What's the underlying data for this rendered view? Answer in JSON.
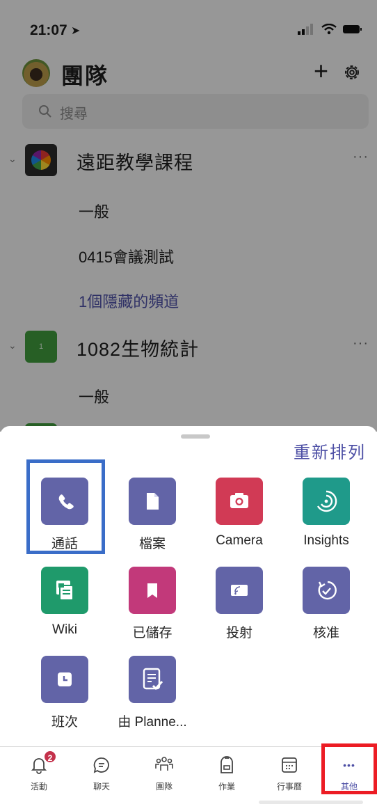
{
  "status": {
    "time": "21:07"
  },
  "header": {
    "title": "團隊",
    "add_label": "+"
  },
  "search": {
    "placeholder": "搜尋"
  },
  "teams": [
    {
      "name": "遠距教學課程",
      "channels": [
        "一般",
        "0415會議測試"
      ],
      "hidden_channels": "1個隱藏的頻道",
      "more": "···"
    },
    {
      "name": "1082生物統計",
      "logo_text": "1",
      "channels": [
        "一般"
      ],
      "more": "···"
    }
  ],
  "sheet": {
    "reorder_label": "重新排列",
    "apps": [
      {
        "label": "通話",
        "icon": "phone-icon",
        "color": "#6264a7"
      },
      {
        "label": "檔案",
        "icon": "file-icon",
        "color": "#6264a7"
      },
      {
        "label": "Camera",
        "icon": "camera-icon",
        "color": "#d13a55"
      },
      {
        "label": "Insights",
        "icon": "insights-icon",
        "color": "#1f9a8a"
      },
      {
        "label": "Wiki",
        "icon": "wiki-icon",
        "color": "#1f9a6b"
      },
      {
        "label": "已儲存",
        "icon": "bookmark-icon",
        "color": "#c2397a"
      },
      {
        "label": "投射",
        "icon": "cast-icon",
        "color": "#6264a7"
      },
      {
        "label": "核准",
        "icon": "approvals-icon",
        "color": "#6264a7"
      },
      {
        "label": "班次",
        "icon": "shifts-clock-icon",
        "color": "#6264a7"
      },
      {
        "label": "由 Planne...",
        "icon": "planner-icon",
        "color": "#6264a7"
      }
    ]
  },
  "tabbar": {
    "tabs": [
      {
        "label": "活動",
        "icon": "bell-icon",
        "badge": "2"
      },
      {
        "label": "聊天",
        "icon": "chat-icon"
      },
      {
        "label": "團隊",
        "icon": "teams-icon"
      },
      {
        "label": "作業",
        "icon": "assignments-icon"
      },
      {
        "label": "行事曆",
        "icon": "calendar-icon"
      },
      {
        "label": "其他",
        "icon": "more-dots-icon",
        "glyph": "•••"
      }
    ]
  },
  "colors": {
    "accent": "#6264a7",
    "highlight_blue": "#3a6dc8",
    "highlight_red": "#ec1c24",
    "badge": "#c4314b"
  }
}
